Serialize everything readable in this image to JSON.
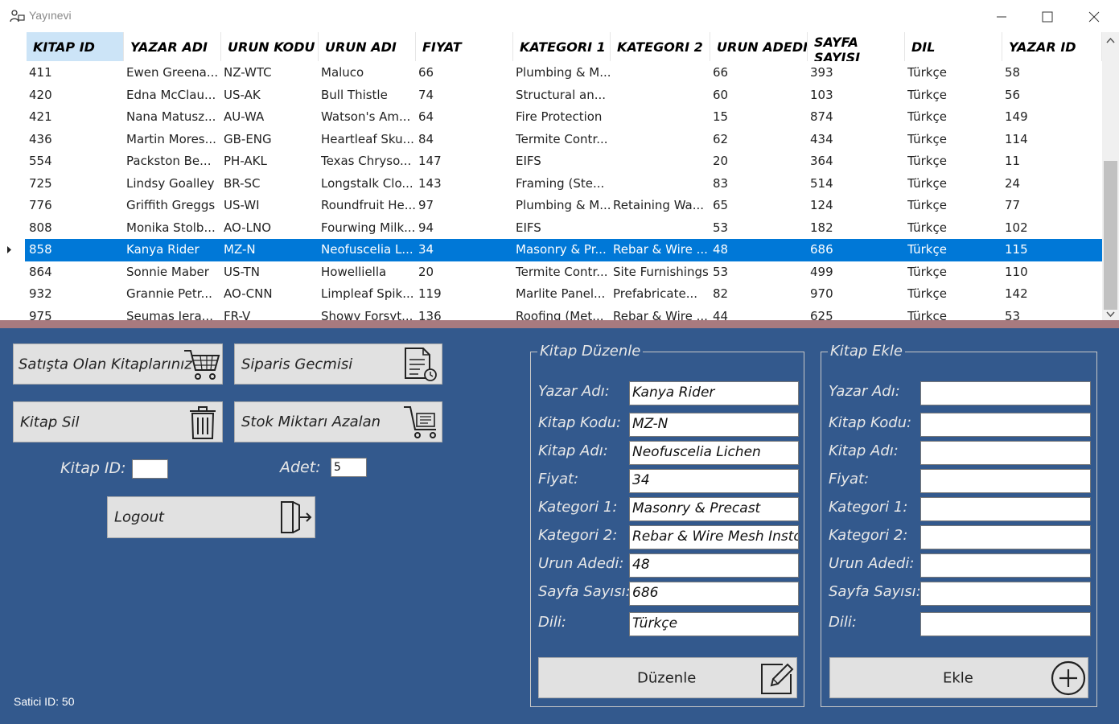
{
  "window": {
    "title": "Yayınevi"
  },
  "grid": {
    "columns": [
      "KITAP ID",
      "YAZAR ADI",
      "URUN KODU",
      "URUN ADI",
      "FIYAT",
      "KATEGORI 1",
      "KATEGORI 2",
      "URUN ADEDI",
      "SAYFA SAYISI",
      "DIL",
      "YAZAR ID"
    ],
    "rows": [
      [
        "411",
        "Ewen Greena...",
        "NZ-WTC",
        "Maluco",
        "66",
        "Plumbing & M...",
        "",
        "66",
        "393",
        "Türkçe",
        "58"
      ],
      [
        "420",
        "Edna McClau...",
        "US-AK",
        "Bull Thistle",
        "74",
        "Structural an...",
        "",
        "60",
        "103",
        "Türkçe",
        "56"
      ],
      [
        "421",
        "Nana Matusz...",
        "AU-WA",
        "Watson's Am...",
        "64",
        "Fire Protection",
        "",
        "15",
        "874",
        "Türkçe",
        "149"
      ],
      [
        "436",
        "Martin Mores...",
        "GB-ENG",
        "Heartleaf Sku...",
        "84",
        "Termite Contr...",
        "",
        "62",
        "434",
        "Türkçe",
        "114"
      ],
      [
        "554",
        "Packston Be...",
        "PH-AKL",
        "Texas Chryso...",
        "147",
        "EIFS",
        "",
        "20",
        "364",
        "Türkçe",
        "11"
      ],
      [
        "725",
        "Lindsy Goalley",
        "BR-SC",
        "Longstalk Clo...",
        "143",
        "Framing (Ste...",
        "",
        "83",
        "514",
        "Türkçe",
        "24"
      ],
      [
        "776",
        "Griffith Greggs",
        "US-WI",
        "Roundfruit He...",
        "97",
        "Plumbing & M...",
        "Retaining Wa...",
        "65",
        "124",
        "Türkçe",
        "77"
      ],
      [
        "808",
        "Monika Stolb...",
        "AO-LNO",
        "Fourwing Milk...",
        "94",
        "EIFS",
        "",
        "53",
        "182",
        "Türkçe",
        "102"
      ],
      [
        "858",
        "Kanya Rider",
        "MZ-N",
        "Neofuscelia L...",
        "34",
        "Masonry & Pr...",
        "Rebar & Wire ...",
        "48",
        "686",
        "Türkçe",
        "115"
      ],
      [
        "864",
        "Sonnie Maber",
        "US-TN",
        "Howelliella",
        "20",
        "Termite Contr...",
        "Site Furnishings",
        "53",
        "499",
        "Türkçe",
        "110"
      ],
      [
        "932",
        "Grannie Petr...",
        "AO-CNN",
        "Limpleaf Spik...",
        "119",
        "Marlite Panel...",
        "Prefabricate...",
        "82",
        "970",
        "Türkçe",
        "142"
      ],
      [
        "975",
        "Seumas Jera...",
        "FR-V",
        "Showy Forsyt...",
        "136",
        "Roofing (Met...",
        "Rebar & Wire ...",
        "44",
        "625",
        "Türkçe",
        "53"
      ]
    ],
    "selected_row": 8
  },
  "actions": {
    "satista_label": "Satışta Olan Kitaplarınız",
    "siparis_label": "Siparis Gecmisi",
    "kitap_sil_label": "Kitap Sil",
    "stok_label": "Stok Miktarı Azalan",
    "kitap_id_label": "Kitap ID:",
    "kitap_id_value": "",
    "adet_label": "Adet:",
    "adet_value": "5",
    "logout_label": "Logout"
  },
  "satici": "Satici ID: 50",
  "edit_form": {
    "legend": "Kitap Düzenle",
    "labels": [
      "Yazar Adı:",
      "Kitap Kodu:",
      "Kitap Adı:",
      "Fiyat:",
      "Kategori 1:",
      "Kategori 2:",
      "Urun Adedi:",
      "Sayfa Sayısı:",
      "Dili:"
    ],
    "values": [
      "Kanya Rider",
      "MZ-N",
      "Neofuscelia Lichen",
      "34",
      "Masonry & Precast",
      "Rebar & Wire Mesh Instc",
      "48",
      "686",
      "Türkçe"
    ],
    "button_label": "Düzenle"
  },
  "add_form": {
    "legend": "Kitap Ekle",
    "labels": [
      "Yazar Adı:",
      "Kitap Kodu:",
      "Kitap Adı:",
      "Fiyat:",
      "Kategori 1:",
      "Kategori 2:",
      "Urun Adedi:",
      "Sayfa Sayısı:",
      "Dili:"
    ],
    "values": [
      "",
      "",
      "",
      "",
      "",
      "",
      "",
      "",
      ""
    ],
    "button_label": "Ekle"
  },
  "colors": {
    "panel": "#33598d",
    "selection": "#0078d7",
    "header_selected": "#cce4f7"
  },
  "icons": [
    "app-icon",
    "minimize-icon",
    "maximize-icon",
    "close-icon",
    "cart-icon",
    "document-clock-icon",
    "trash-icon",
    "cart-low-stock-icon",
    "logout-door-icon",
    "edit-pen-icon",
    "plus-circle-icon",
    "row-pointer-icon",
    "scroll-up-icon",
    "scroll-down-icon"
  ]
}
